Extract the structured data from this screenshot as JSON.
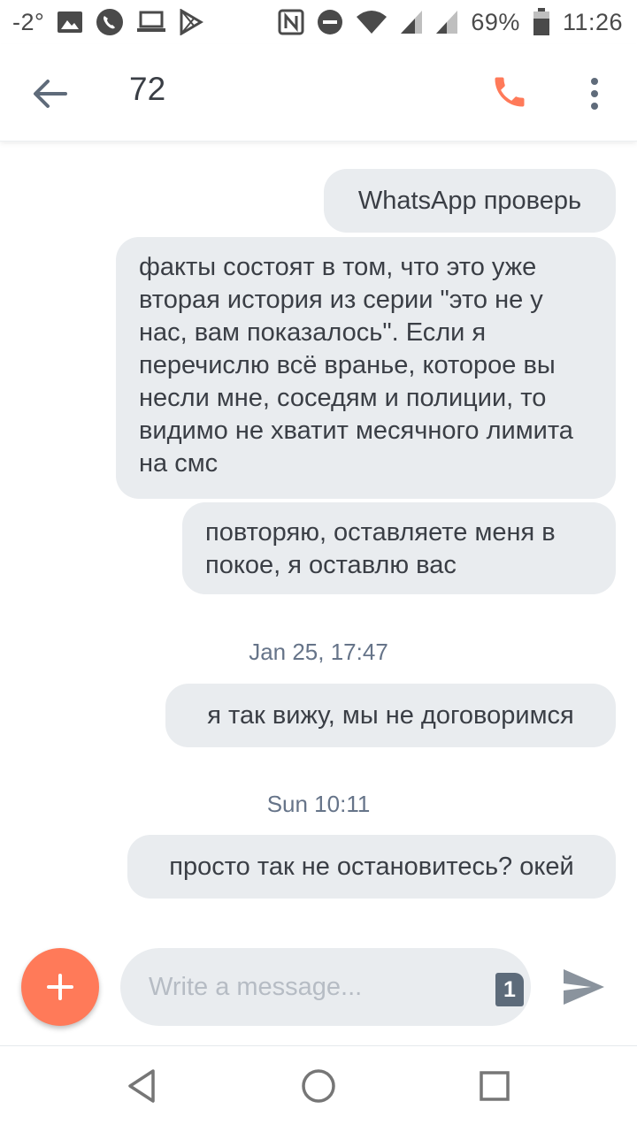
{
  "status_bar": {
    "temperature": "-2°",
    "battery_percent": "69%",
    "time": "11:26",
    "left_icons": [
      "image-icon",
      "phone-call-icon",
      "laptop-icon",
      "play-store-icon"
    ],
    "right_icons": [
      "nfc-icon",
      "do-not-disturb-icon",
      "wifi-icon",
      "signal-icon",
      "signal-icon",
      "battery-icon"
    ]
  },
  "header": {
    "title": "72",
    "accent_color": "#ff7a59",
    "icons": [
      "arrow-back-icon",
      "phone-icon",
      "more-vert-icon"
    ]
  },
  "messages": [
    {
      "type": "message",
      "text": "WhatsApp проверь"
    },
    {
      "type": "message",
      "text": "факты состоят в том, что это уже вторая история из серии \"это не у нас, вам показалось\". Если я перечислю всё вранье, которое вы несли мне, соседям и полиции, то видимо не хватит месячного лимита на смс"
    },
    {
      "type": "message",
      "text": "повторяю, оставляете меня в покое, я оставлю вас"
    },
    {
      "type": "timestamp",
      "text": "Jan 25, 17:47"
    },
    {
      "type": "message",
      "text": "я так вижу, мы не договоримся"
    },
    {
      "type": "timestamp",
      "text": "Sun 10:11"
    },
    {
      "type": "message",
      "text": "просто так не остановитесь? окей"
    }
  ],
  "composer": {
    "placeholder": "Write a message...",
    "sim_slot": "1",
    "icons": [
      "plus-icon",
      "sim-icon",
      "send-icon"
    ]
  },
  "nav_bar": {
    "icons": [
      "back-triangle-icon",
      "home-circle-icon",
      "recents-square-icon"
    ]
  }
}
